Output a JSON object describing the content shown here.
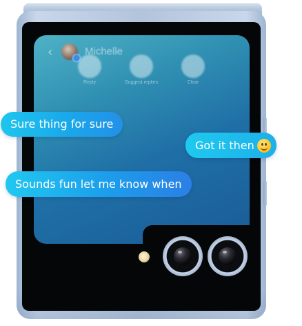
{
  "header": {
    "back_glyph": "‹",
    "contact_name": "Michelle"
  },
  "actions": [
    {
      "label": "Reply",
      "icon": "reply-icon"
    },
    {
      "label": "Suggest replies",
      "icon": "suggest-replies-icon"
    },
    {
      "label": "Clear",
      "icon": "clear-icon"
    }
  ],
  "messages": [
    {
      "text": "Sure thing for sure",
      "side": "incoming"
    },
    {
      "text": "Got it then",
      "side": "outgoing",
      "emoji": "smiley-emoji"
    },
    {
      "text": "Sounds fun let me know when",
      "side": "incoming"
    }
  ],
  "colors": {
    "screen_top": "#4fb2c6",
    "screen_bottom": "#1a5c98",
    "bubble": "#1eb6ee",
    "phone_frame": "#b2c4dc"
  }
}
